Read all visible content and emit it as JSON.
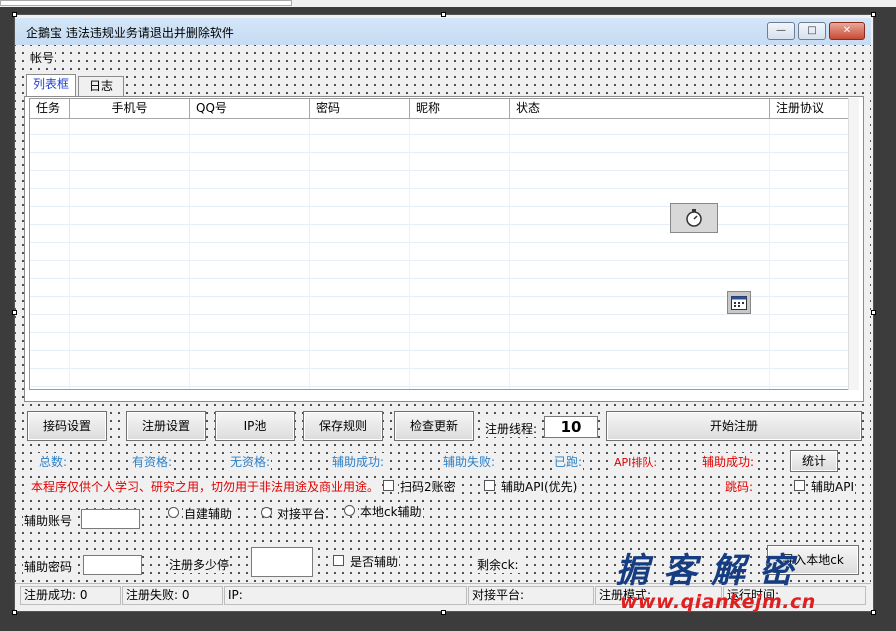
{
  "window": {
    "title": "企鵝宝  违法违规业务请退出并删除软件"
  },
  "menu": {
    "account": "帐号"
  },
  "tabs": [
    "列表框",
    "日志"
  ],
  "table": {
    "columns": [
      "任务",
      "手机号",
      "QQ号",
      "密码",
      "昵称",
      "状态",
      "注册协议"
    ],
    "rows": []
  },
  "buttons": {
    "code_settings": "接码设置",
    "register_settings": "注册设置",
    "ip_pool": "IP池",
    "save_rules": "保存规则",
    "check_update": "检查更新",
    "start_register": "开始注册",
    "stats": "统计",
    "import": "导入本地ck"
  },
  "threads": {
    "label": "注册线程:",
    "value": "10"
  },
  "stats_row": {
    "total": "总数:",
    "qualified": "有资格:",
    "unqualified": "无资格:",
    "assist_success": "辅助成功:",
    "assist_fail": "辅助失败:",
    "ran": "已跑:",
    "api_queue": "API排队:",
    "assist_success2": "辅助成功:"
  },
  "warning": "本程序仅供个人学习、研究之用，切勿用于非法用途及商业用途。",
  "options": {
    "scan_2fa": "扫码2账密",
    "assist_api_priority": "辅助API(优先)",
    "skip_code": "跳码:",
    "assist_api": "辅助API"
  },
  "assist": {
    "account_label": "辅助账号",
    "password_label": "辅助密码",
    "radio_self": "自建辅助",
    "radio_platform": "对接平台",
    "radio_local": "本地ck辅助",
    "pause_label": "注册多少停",
    "is_assist": "是否辅助",
    "remaining": "剩余ck:"
  },
  "status_bar": {
    "reg_success": "注册成功: 0",
    "reg_fail": "注册失败: 0",
    "ip": "IP:",
    "platform": "对接平台:",
    "mode": "注册模式:",
    "runtime": "运行时间:"
  },
  "watermark": {
    "main": "掮客解密",
    "url": "www.qiankejm.cn"
  },
  "icons": [
    "stopwatch-icon",
    "calendar-icon",
    "minimize-icon",
    "maximize-icon",
    "close-icon"
  ]
}
